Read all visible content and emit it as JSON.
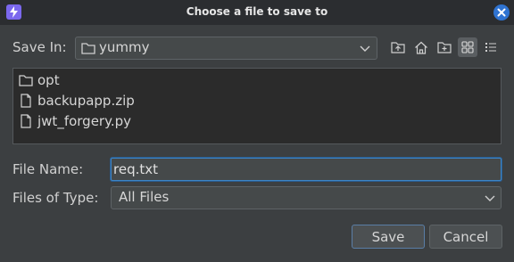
{
  "window": {
    "title": "Choose a file to save to"
  },
  "toolbar": {
    "save_in_label": "Save In:",
    "save_in_value": "yummy",
    "buttons": [
      "up-folder-icon",
      "home-icon",
      "new-folder-icon",
      "list-view-icon",
      "details-view-icon"
    ],
    "active_view": "list-view"
  },
  "files": [
    {
      "name": "opt",
      "icon": "folder-icon"
    },
    {
      "name": "backupapp.zip",
      "icon": "file-icon"
    },
    {
      "name": "jwt_forgery.py",
      "icon": "file-icon"
    }
  ],
  "file_name": {
    "label": "File Name:",
    "value": "req.txt"
  },
  "file_type": {
    "label": "Files of Type:",
    "value": "All Files"
  },
  "actions": {
    "save": "Save",
    "cancel": "Cancel"
  },
  "colors": {
    "background": "#3c3f41",
    "titlebar": "#2b2d30",
    "accent": "#2f73d1",
    "app_icon": "#7b68ee"
  }
}
